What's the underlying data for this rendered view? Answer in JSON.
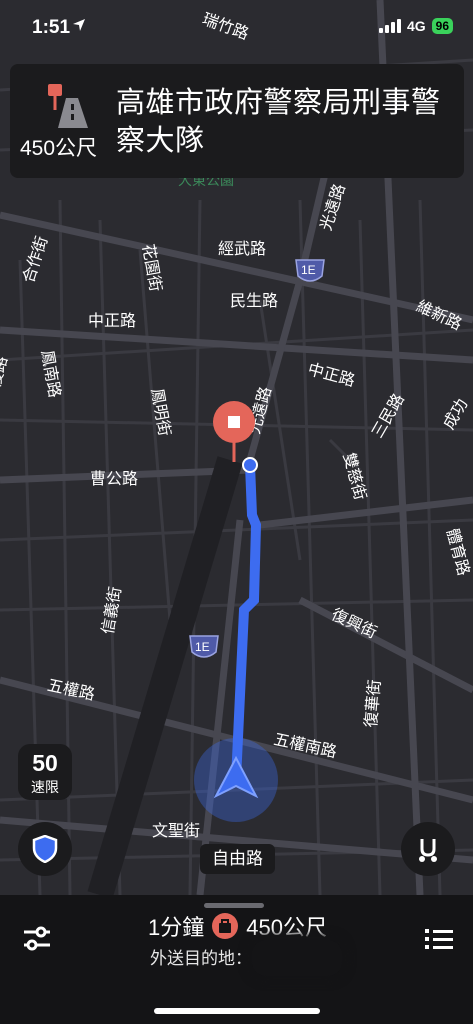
{
  "status": {
    "time": "1:51",
    "network": "4G",
    "battery": "96"
  },
  "banner": {
    "distance": "450公尺",
    "destination": "高雄市政府警察局刑事警察大隊"
  },
  "map": {
    "streets": {
      "ruizhu": "瑞竹路",
      "guangyuan_top": "光遠路",
      "hezuo": "合作街",
      "jingwu": "經武路",
      "huaguo": "花園街",
      "minsheng": "民生路",
      "weixin": "維新路",
      "zhongzheng_left": "中正路",
      "fengnan": "鳳南路",
      "guangfu": "光復路",
      "fengming": "鳳明街",
      "guangyuan_mid": "光遠路",
      "zhongzheng_right": "中正路",
      "sanmin": "三民路",
      "cheng": "成功",
      "shuangci": "雙慈街",
      "cao": "曹公路",
      "tiyu": "體育路",
      "xinyi": "信義街",
      "fuxing": "復興街",
      "wuquan": "五權路",
      "fuhua": "復華街",
      "wuquannan": "五權南路",
      "wensheng": "文聖街"
    },
    "park": "大東公園",
    "highway": "1E",
    "current_road": "自由路"
  },
  "speed_limit": {
    "value": "50",
    "unit": "速限"
  },
  "trip": {
    "eta": "1分鐘",
    "distance": "450公尺",
    "destination_label": "外送目的地："
  },
  "colors": {
    "route": "#3d6cf0",
    "destination_pin": "#e4665a",
    "background": "#2b2b30"
  },
  "icons": [
    "location-arrow-icon",
    "turn-road-icon",
    "shield-icon",
    "route-options-icon",
    "settings-sliders-icon",
    "list-icon",
    "bag-icon",
    "navigation-arrow-icon"
  ]
}
